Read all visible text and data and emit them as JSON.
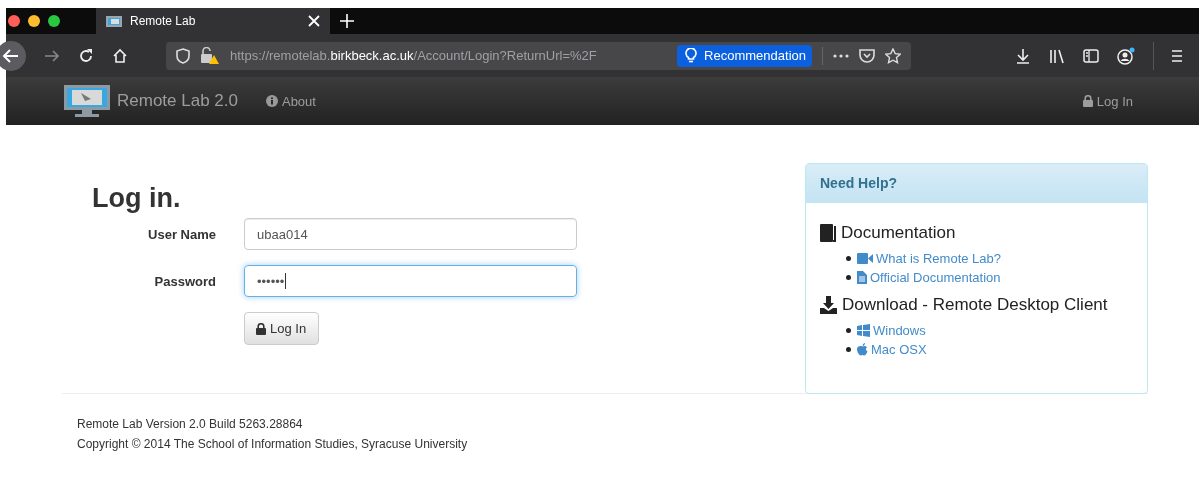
{
  "browser": {
    "tabs": [
      {
        "title": "Remote Lab",
        "selected": true
      }
    ],
    "address": {
      "prefix": "https://remotelab.",
      "domain": "birkbeck.ac.uk",
      "path": "/Account/Login?ReturnUrl=%2F"
    },
    "recommendation": "Recommendation"
  },
  "navbar": {
    "brand": "Remote Lab 2.0",
    "links": [
      {
        "label": "About",
        "kind": "info"
      }
    ],
    "right_link": {
      "label": "Log In",
      "kind": "lock"
    }
  },
  "login": {
    "title": "Log in.",
    "fields": [
      {
        "label": "User Name",
        "value": "ubaa014",
        "focused": false
      },
      {
        "label": "Password",
        "value": "••••••",
        "focused": true
      }
    ],
    "button": "Log In"
  },
  "help": {
    "title": "Need Help?",
    "sections": [
      {
        "heading": "Documentation",
        "kind": "book",
        "links": [
          {
            "label": "What is Remote Lab?",
            "kind": "video"
          },
          {
            "label": "Official Documentation",
            "kind": "file"
          }
        ]
      },
      {
        "heading": "Download - Remote Desktop Client",
        "kind": "download",
        "links": [
          {
            "label": "Windows",
            "kind": "windows"
          },
          {
            "label": "Mac OSX",
            "kind": "apple"
          }
        ]
      }
    ]
  },
  "footer": [
    "Remote Lab Version 2.0 Build 5263.28864",
    "Copyright © 2014 The School of Information Studies, Syracuse University"
  ]
}
